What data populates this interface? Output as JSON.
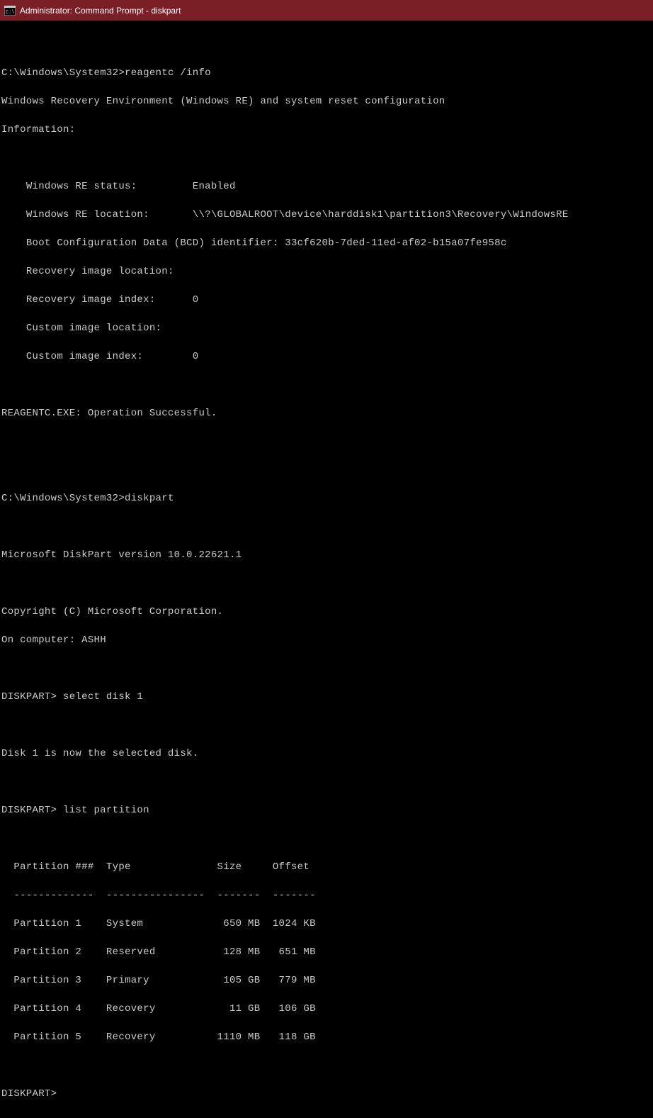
{
  "window": {
    "title": "Administrator: Command Prompt - diskpart"
  },
  "terminal": {
    "prompt1_path": "C:\\Windows\\System32>",
    "command1": "reagentc /info",
    "reagentc": {
      "header": "Windows Recovery Environment (Windows RE) and system reset configuration",
      "header2": "Information:",
      "indent": "    ",
      "status_label": "Windows RE status:         ",
      "status_value": "Enabled",
      "location_label": "Windows RE location:       ",
      "location_value": "\\\\?\\GLOBALROOT\\device\\harddisk1\\partition3\\Recovery\\WindowsRE",
      "bcd_label": "Boot Configuration Data (BCD) identifier: ",
      "bcd_value": "33cf620b-7ded-11ed-af02-b15a07fe958c",
      "rec_img_loc_label": "Recovery image location:",
      "rec_img_idx_label": "Recovery image index:      ",
      "rec_img_idx_value": "0",
      "cust_img_loc_label": "Custom image location:",
      "cust_img_idx_label": "Custom image index:        ",
      "cust_img_idx_value": "0",
      "success": "REAGENTC.EXE: Operation Successful."
    },
    "prompt2_path": "C:\\Windows\\System32>",
    "command2": "diskpart",
    "diskpart": {
      "version": "Microsoft DiskPart version 10.0.22621.1",
      "copyright": "Copyright (C) Microsoft Corporation.",
      "computer": "On computer: ASHH",
      "prompt3": "DISKPART> ",
      "command3": "select disk 1",
      "select_result": "Disk 1 is now the selected disk.",
      "prompt4": "DISKPART> ",
      "command4": "list partition",
      "table": {
        "header": "  Partition ###  Type              Size     Offset",
        "divider": "  -------------  ----------------  -------  -------",
        "rows": [
          "  Partition 1    System             650 MB  1024 KB",
          "  Partition 2    Reserved           128 MB   651 MB",
          "  Partition 3    Primary            105 GB   779 MB",
          "  Partition 4    Recovery            11 GB   106 GB",
          "  Partition 5    Recovery          1110 MB   118 GB"
        ]
      },
      "prompt5": "DISKPART>"
    }
  }
}
